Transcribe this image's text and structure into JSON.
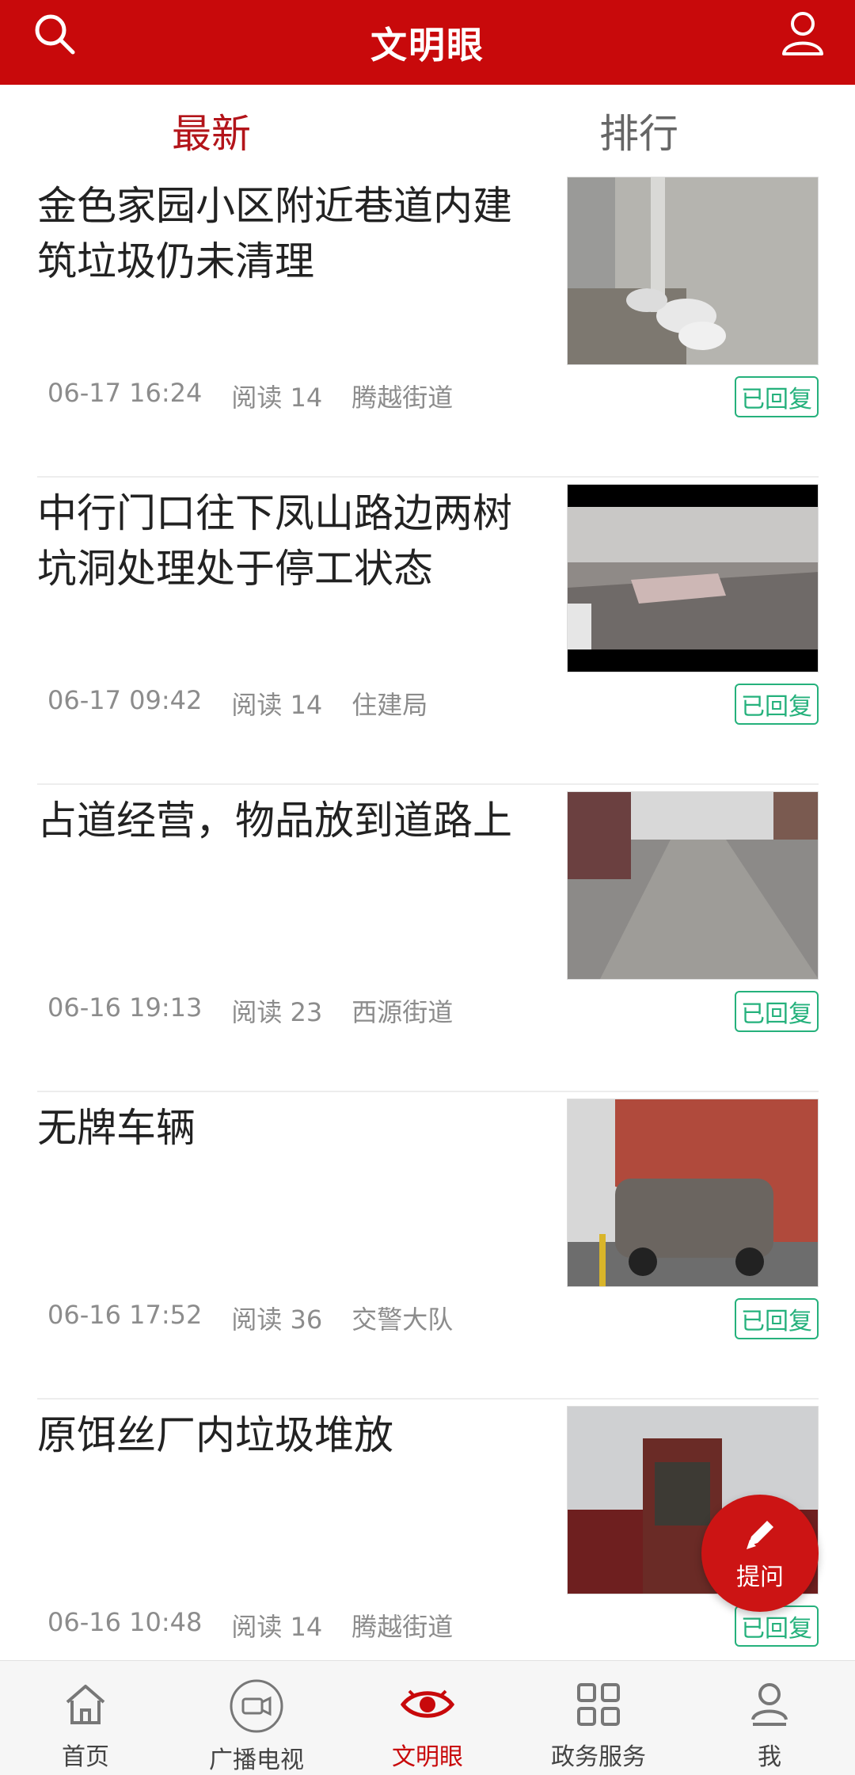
{
  "header": {
    "title": "文明眼"
  },
  "tabs": [
    {
      "label": "最新"
    },
    {
      "label": "排行"
    }
  ],
  "posts": [
    {
      "title": "金色家园小区附近巷道内建筑垃圾仍未清理",
      "date": "06-17 16:24",
      "reads": "阅读 14",
      "dept": "腾越街道",
      "status": "已回复"
    },
    {
      "title": "中行门口往下凤山路边两树坑洞处理处于停工状态",
      "date": "06-17 09:42",
      "reads": "阅读 14",
      "dept": "住建局",
      "status": "已回复"
    },
    {
      "title": "占道经营，物品放到道路上",
      "date": "06-16 19:13",
      "reads": "阅读 23",
      "dept": "西源街道",
      "status": "已回复"
    },
    {
      "title": "无牌车辆",
      "date": "06-16 17:52",
      "reads": "阅读 36",
      "dept": "交警大队",
      "status": "已回复"
    },
    {
      "title": "原饵丝厂内垃圾堆放",
      "date": "06-16 10:48",
      "reads": "阅读 14",
      "dept": "腾越街道",
      "status": "已回复"
    }
  ],
  "fab": {
    "label": "提问"
  },
  "bottom_nav": [
    {
      "label": "首页",
      "icon": "home-icon"
    },
    {
      "label": "广播电视",
      "icon": "video-camera-icon"
    },
    {
      "label": "文明眼",
      "icon": "eye-icon"
    },
    {
      "label": "政务服务",
      "icon": "grid-icon"
    },
    {
      "label": "我",
      "icon": "person-icon"
    }
  ],
  "colors": {
    "brand_red": "#c8090b",
    "tab_active": "#b3141a",
    "reply_green": "#25b17c"
  }
}
